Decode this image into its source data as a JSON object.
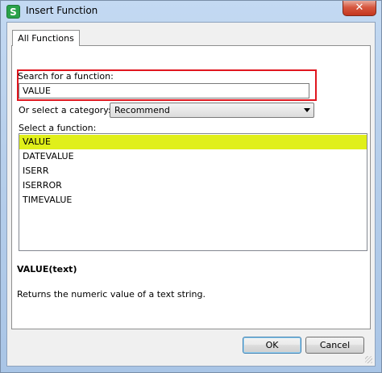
{
  "window": {
    "title": "Insert Function",
    "app_icon_letter": "S",
    "close_glyph": "✕"
  },
  "tabs": [
    {
      "label": "All Functions"
    }
  ],
  "search": {
    "label": "Search for a function:",
    "value": "VALUE"
  },
  "category": {
    "label": "Or select a category:",
    "selected": "Recommend"
  },
  "function_list": {
    "label": "Select a function:",
    "items": [
      "VALUE",
      "DATEVALUE",
      "ISERR",
      "ISERROR",
      "TIMEVALUE"
    ],
    "selected_index": 0
  },
  "details": {
    "syntax": "VALUE(text)",
    "description": "Returns the numeric value of a text string."
  },
  "buttons": {
    "ok": "OK",
    "cancel": "Cancel"
  },
  "colors": {
    "selection_highlight": "#e0ef1a",
    "search_highlight_border": "#e0161f",
    "app_icon": "#2aa24a",
    "close_button": "#d6573f"
  }
}
